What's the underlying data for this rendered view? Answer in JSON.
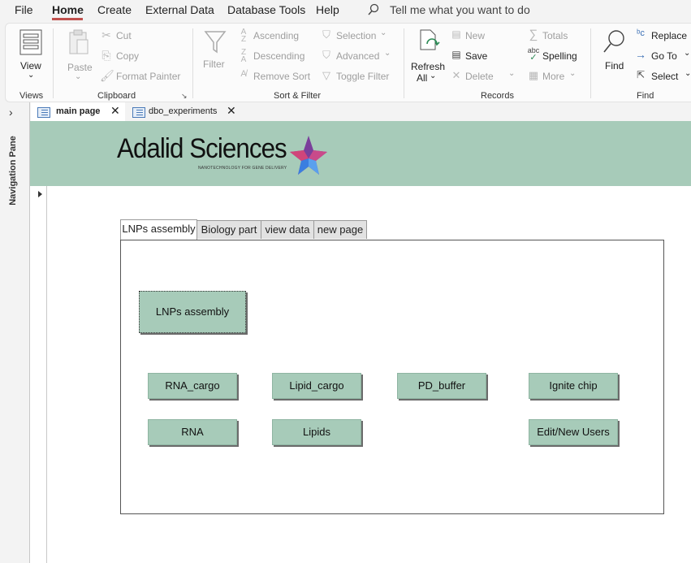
{
  "menu": {
    "items": [
      "File",
      "Home",
      "Create",
      "External Data",
      "Database Tools",
      "Help"
    ],
    "active": "Home",
    "search_placeholder": "Tell me what you want to do"
  },
  "ribbon": {
    "views": {
      "view_label": "View",
      "group_label": "Views"
    },
    "clipboard": {
      "paste": "Paste",
      "cut": "Cut",
      "copy": "Copy",
      "format_painter": "Format Painter",
      "group_label": "Clipboard"
    },
    "sort_filter": {
      "filter": "Filter",
      "ascending": "Ascending",
      "descending": "Descending",
      "remove_sort": "Remove Sort",
      "selection": "Selection",
      "advanced": "Advanced",
      "toggle_filter": "Toggle Filter",
      "group_label": "Sort & Filter"
    },
    "records": {
      "refresh": "Refresh",
      "refresh_all": "All",
      "new": "New",
      "save": "Save",
      "delete": "Delete",
      "totals": "Totals",
      "spelling": "Spelling",
      "more": "More",
      "group_label": "Records"
    },
    "find": {
      "find": "Find",
      "replace": "Replace",
      "go_to": "Go To",
      "select": "Select",
      "group_label": "Find"
    }
  },
  "nav_pane": {
    "label": "Navigation Pane"
  },
  "doc_tabs": [
    {
      "label": "main page",
      "active": true
    },
    {
      "label": "dbo_experiments",
      "active": false
    }
  ],
  "header": {
    "logo_text": "Adalid Sciences",
    "tagline": "NANOTECHNOLOGY FOR GENE DELIVERY",
    "background": "#a7cbb9"
  },
  "form_tabs": [
    "LNPs assembly",
    "Biology part",
    "view data",
    "new page"
  ],
  "buttons": {
    "lnps_assembly": "LNPs assembly",
    "rna_cargo": "RNA_cargo",
    "lipid_cargo": "Lipid_cargo",
    "pd_buffer": "PD_buffer",
    "ignite_chip": "Ignite chip",
    "rna": "RNA",
    "lipids": "Lipids",
    "edit_users": "Edit/New Users"
  },
  "colors": {
    "accent": "#c0504d",
    "button_green": "#a7cbb9"
  }
}
